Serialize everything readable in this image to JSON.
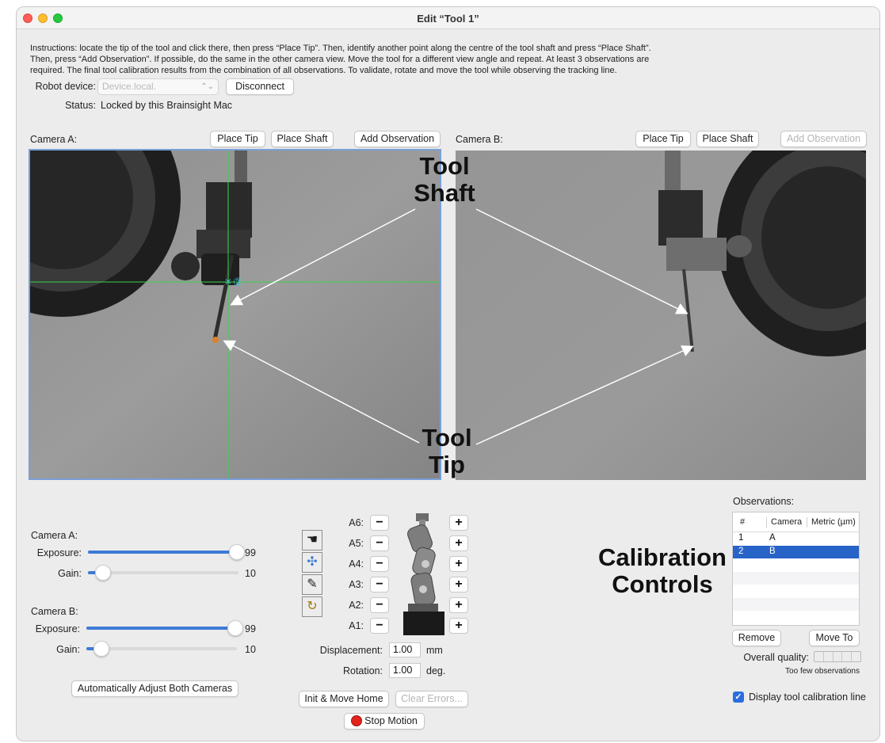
{
  "window": {
    "title": "Edit “Tool 1”"
  },
  "instructions": "Instructions: locate the tip of the tool and click there, then press “Place Tip”. Then, identify another point along the centre of the tool shaft and press “Place Shaft”. Then, press “Add Observation”. If possible, do the same in the other camera view. Move the tool for a different view angle and repeat. At least 3 observations are required. The final tool calibration results from the combination of all observations. To validate, rotate and move the tool while observing the tracking line.",
  "robot": {
    "device_label": "Robot device:",
    "device_value": "Device.local.",
    "disconnect_label": "Disconnect",
    "status_label": "Status:",
    "status_value": "Locked by this Brainsight Mac"
  },
  "camera_a": {
    "label": "Camera A:",
    "place_tip": "Place Tip",
    "place_shaft": "Place Shaft",
    "add_observation": "Add Observation",
    "marker_label": "②"
  },
  "camera_b": {
    "label": "Camera B:",
    "place_tip": "Place Tip",
    "place_shaft": "Place Shaft",
    "add_observation": "Add Observation"
  },
  "annotations": {
    "tool_shaft_line1": "Tool",
    "tool_shaft_line2": "Shaft",
    "tool_tip_line1": "Tool",
    "tool_tip_line2": "Tip",
    "calibration_line1": "Calibration",
    "calibration_line2": "Controls"
  },
  "camera_controls": {
    "a_heading": "Camera A:",
    "a_exposure_label": "Exposure:",
    "a_exposure_value": "99",
    "a_exposure_fraction": 0.99,
    "a_gain_label": "Gain:",
    "a_gain_value": "10",
    "a_gain_fraction": 0.1,
    "b_heading": "Camera B:",
    "b_exposure_label": "Exposure:",
    "b_exposure_value": "99",
    "b_exposure_fraction": 0.99,
    "b_gain_label": "Gain:",
    "b_gain_value": "10",
    "b_gain_fraction": 0.1,
    "auto_adjust_label": "Automatically Adjust Both Cameras"
  },
  "robot_jog": {
    "axes": [
      {
        "label": "A6:",
        "minus": "−",
        "plus": "+"
      },
      {
        "label": "A5:",
        "minus": "−",
        "plus": "+"
      },
      {
        "label": "A4:",
        "minus": "−",
        "plus": "+"
      },
      {
        "label": "A3:",
        "minus": "−",
        "plus": "+"
      },
      {
        "label": "A2:",
        "minus": "−",
        "plus": "+"
      },
      {
        "label": "A1:",
        "minus": "−",
        "plus": "+"
      }
    ],
    "displacement_label": "Displacement:",
    "displacement_value": "1.00",
    "displacement_unit": "mm",
    "rotation_label": "Rotation:",
    "rotation_value": "1.00",
    "rotation_unit": "deg.",
    "init_home_label": "Init & Move Home",
    "clear_errors_label": "Clear Errors...",
    "stop_motion_label": "Stop Motion",
    "tool_icons": [
      "hand-tool-icon",
      "color-tool-icon",
      "pencil-icon",
      "rotate-icon"
    ]
  },
  "observations": {
    "heading": "Observations:",
    "columns": [
      "#",
      "Camera",
      "Metric (µm)"
    ],
    "rows": [
      {
        "num": "1",
        "camera": "A",
        "metric": ""
      },
      {
        "num": "2",
        "camera": "B",
        "metric": ""
      }
    ],
    "selected_row": 1,
    "remove_label": "Remove",
    "move_to_label": "Move To",
    "quality_label": "Overall quality:",
    "quality_status": "Too few observations",
    "display_line_label": "Display tool calibration line",
    "display_line_checked": true
  },
  "colors": {
    "accent": "#2b6de0",
    "selection": "#2863c7",
    "camera_a_border": "#7a9fd8",
    "crosshair": "#3bd24b",
    "marker": "#3ec7d4",
    "tip_marker": "#e0802b",
    "stop": "#e2231a"
  }
}
